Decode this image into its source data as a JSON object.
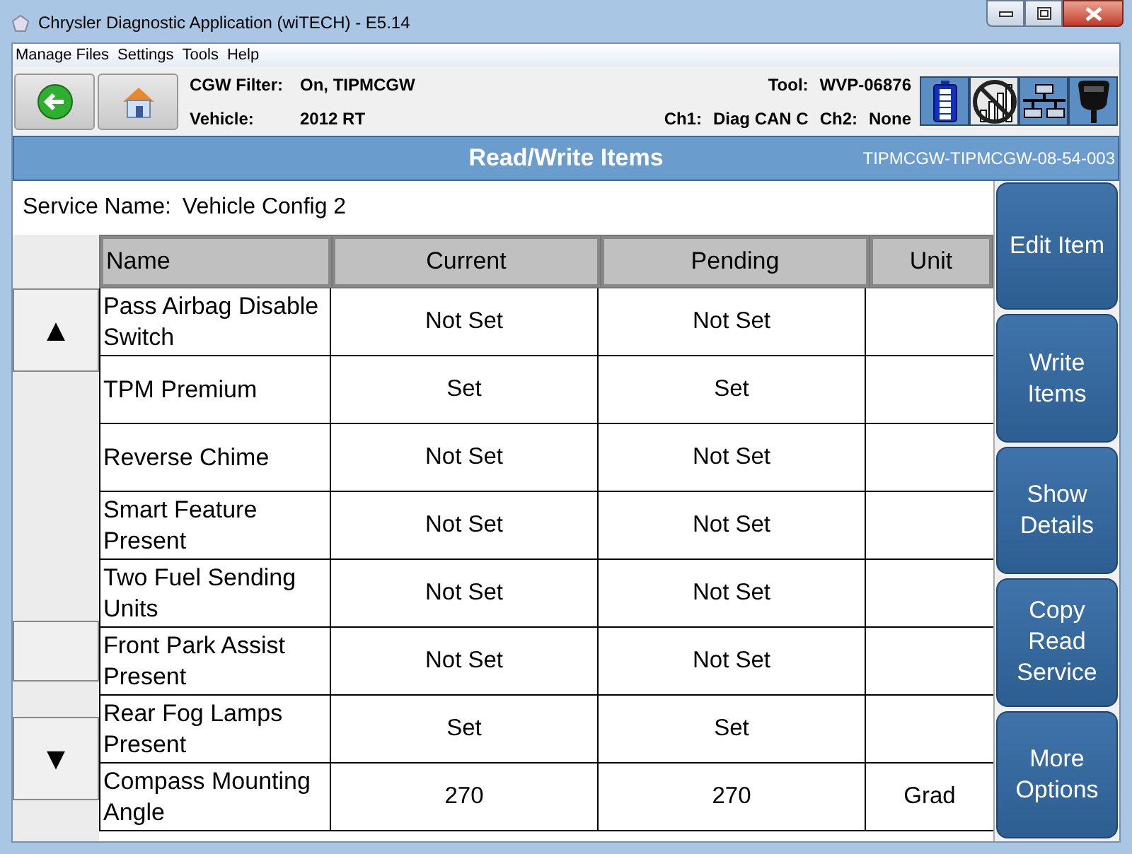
{
  "window": {
    "title": "Chrysler Diagnostic Application (wiTECH) - E5.14"
  },
  "menu": [
    "Manage Files",
    "Settings",
    "Tools",
    "Help"
  ],
  "status": {
    "cgw_filter_label": "CGW Filter:",
    "cgw_filter": "On, TIPMCGW",
    "vehicle_label": "Vehicle:",
    "vehicle": "2012 RT",
    "tool_label": "Tool:",
    "tool": "WVP-06876",
    "ch1_label": "Ch1:",
    "ch1": "Diag CAN C",
    "ch2_label": "Ch2:",
    "ch2": "None"
  },
  "header": {
    "title": "Read/Write Items",
    "id": "TIPMCGW-TIPMCGW-08-54-003"
  },
  "service": {
    "label": "Service Name:",
    "value": "Vehicle Config 2"
  },
  "scroll": {
    "up": "▲",
    "down": "▼"
  },
  "table": {
    "columns": [
      "Name",
      "Current",
      "Pending",
      "Unit"
    ],
    "rows": [
      {
        "name": "Pass Airbag Disable Switch",
        "current": "Not Set",
        "pending": "Not Set"
      },
      {
        "name": "TPM Premium",
        "current": "Set",
        "pending": "Set"
      },
      {
        "name": "Reverse Chime",
        "current": "Not Set",
        "pending": "Not Set"
      },
      {
        "name": "Smart Feature Present",
        "current": "Not Set",
        "pending": "Not Set"
      },
      {
        "name": "Two Fuel Sending Units",
        "current": "Not Set",
        "pending": "Not Set"
      },
      {
        "name": "Front Park Assist Present",
        "current": "Not Set",
        "pending": "Not Set"
      },
      {
        "name": "Rear Fog Lamps Present",
        "current": "Set",
        "pending": "Set"
      },
      {
        "name": "Compass Mounting Angle",
        "current": "270",
        "pending": "270",
        "unit": "Grad"
      }
    ]
  },
  "actions": [
    "Edit Item",
    "Write Items",
    "Show Details",
    "Copy Read Service",
    "More Options"
  ]
}
